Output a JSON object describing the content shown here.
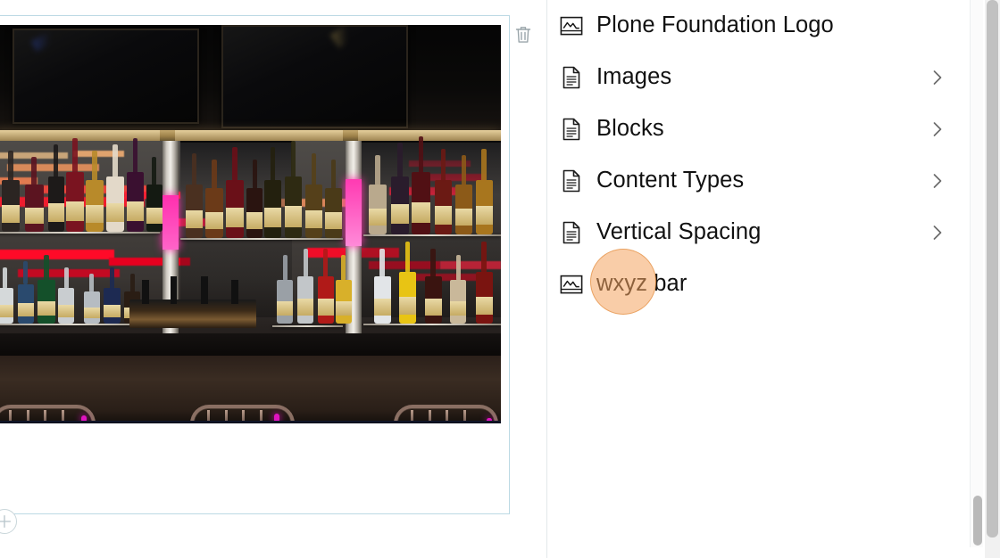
{
  "editor": {
    "block": {
      "name": "image-block",
      "selected": true,
      "image_alt": "Dimly lit bar interior with backlit shelves of liquor bottles, overhead television screens and three metal bar stools",
      "accent_border": "#bcd9e4"
    },
    "toolbar": {
      "delete_icon": "trash-icon",
      "delete_label": "Delete block"
    },
    "add_block": {
      "icon": "plus-icon",
      "label": "Add block"
    }
  },
  "sidebar": {
    "items": [
      {
        "label": "Plone Foundation Logo",
        "icon": "image-icon",
        "has_chevron": false
      },
      {
        "label": "Images",
        "icon": "document-icon",
        "has_chevron": true
      },
      {
        "label": "Blocks",
        "icon": "document-icon",
        "has_chevron": true
      },
      {
        "label": "Content Types",
        "icon": "document-icon",
        "has_chevron": true
      },
      {
        "label": "Vertical Spacing",
        "icon": "document-icon",
        "has_chevron": true
      },
      {
        "label": "wxyz bar",
        "icon": "image-icon",
        "has_chevron": false
      }
    ],
    "chevron_icon": "chevron-right-icon"
  },
  "cursor": {
    "highlight_color": "#f4a460",
    "target": "wxyz bar"
  },
  "scrollbars": {
    "inner": {
      "name": "panel-scrollbar",
      "thumb_color": "#b9b9b9"
    },
    "outer": {
      "name": "page-scrollbar",
      "thumb_color": "#c1c1c1"
    }
  }
}
